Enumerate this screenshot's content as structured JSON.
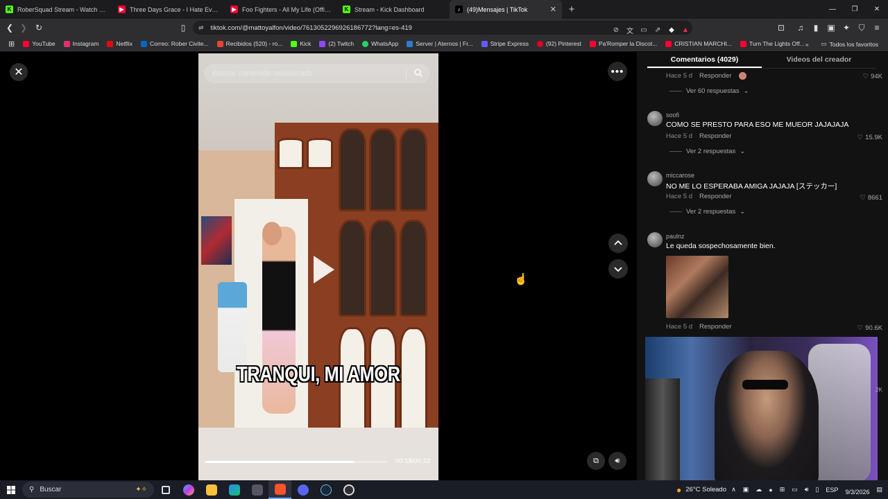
{
  "tabs": [
    {
      "title": "RoberSquad Stream - Watch Live",
      "color": "#53fc18",
      "glyph": "K"
    },
    {
      "title": "Three Days Grace - I Hate Everything",
      "color": "#ff0033",
      "glyph": "▶"
    },
    {
      "title": "Foo Fighters - All My Life (Official HD",
      "color": "#ff0033",
      "glyph": "▶"
    },
    {
      "title": "Stream - Kick Dashboard",
      "color": "#53fc18",
      "glyph": "K"
    },
    {
      "title": "(49)Mensajes | TikTok",
      "color": "#ffffff",
      "glyph": "♪",
      "active": true
    }
  ],
  "url": "tiktok.com/@mattoyalfon/video/7613052296926186772?lang=es-419",
  "bookmarks": [
    {
      "label": "YouTube",
      "color": "#ff0033"
    },
    {
      "label": "Instagram",
      "color": "#e1306c"
    },
    {
      "label": "Netflix",
      "color": "#e50914"
    },
    {
      "label": "Correo: Rober Civite...",
      "color": "#0a66c2"
    },
    {
      "label": "Recibidos (520) - ro...",
      "color": "#ea4335"
    },
    {
      "label": "Kick",
      "color": "#53fc18"
    },
    {
      "label": "(2) Twitch",
      "color": "#9146ff"
    },
    {
      "label": "WhatsApp",
      "color": "#25d366"
    },
    {
      "label": "Server | Aternos | Fr...",
      "color": "#2f7cd6"
    },
    {
      "label": "Stripe Express",
      "color": "#635bff"
    },
    {
      "label": "(92) Pinterest",
      "color": "#e60023"
    },
    {
      "label": "Pa'Romper la Discot...",
      "color": "#ff0033"
    },
    {
      "label": "CRISTIAN MARCHI...",
      "color": "#ff0033"
    },
    {
      "label": "Turn The Lights Off...",
      "color": "#ff0033"
    }
  ],
  "bookmarks_all": "Todos los favoritos",
  "search": {
    "placeholder": "Buscar contenido relacionado"
  },
  "video": {
    "caption": "TRANQUI, MI AMOR",
    "time": "00:18/00:22",
    "progress": 0.82
  },
  "panel": {
    "tab_comments": "Comentarios (4029)",
    "tab_creator": "Videos del creador"
  },
  "comments": [
    {
      "top_meta_time": "Hace 5 d",
      "top_meta_reply": "Responder",
      "likes": "94K",
      "replies": "Ver 60 respuestas"
    },
    {
      "user": "soofi",
      "text": "COMO SE PRESTO PARA ESO ME MUEOR JAJAJAJA",
      "time": "Hace 5 d",
      "reply": "Responder",
      "likes": "15.9K",
      "replies": "Ver 2 respuestas"
    },
    {
      "user": "miccarose",
      "text": "NO ME LO ESPERABA AMIGA JAJAJA [ステッカー]",
      "time": "Hace 5 d",
      "reply": "Responder",
      "likes": "8661",
      "replies": "Ver 2 respuestas"
    },
    {
      "user": "paulnz",
      "text": "Le queda sospechosamente bien.",
      "time": "Hace 5 d",
      "reply": "Responder",
      "likes": "90.6K"
    }
  ],
  "cam_peek": "2K",
  "taskbar": {
    "search": "Buscar",
    "weather": "26°C Soleado",
    "lang": "ESP",
    "date": "9/3/2026"
  },
  "colors": {
    "accent": "#fe2c55",
    "panel": "#121212"
  }
}
